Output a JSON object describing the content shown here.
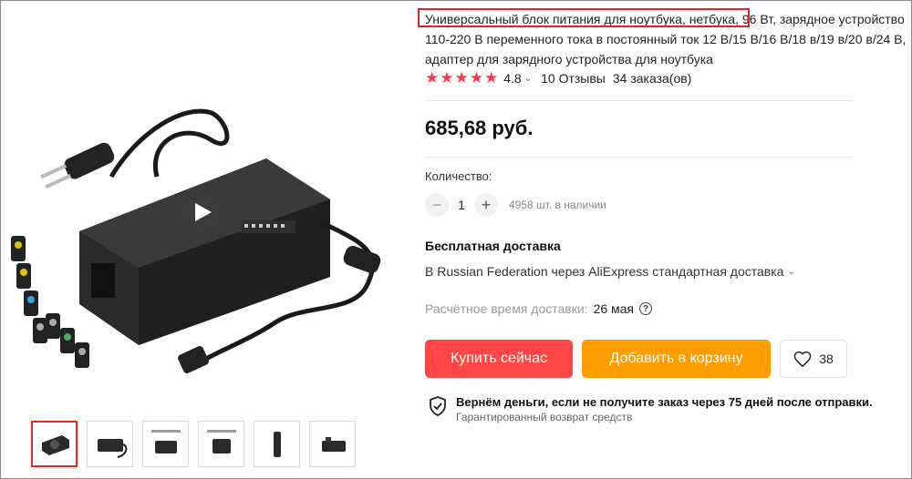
{
  "product": {
    "title": "Универсальный блок питания для ноутбука, нетбука, 96 Вт, зарядное устройство 110-220 В переменного тока в постоянный ток 12 В/15 В/16 В/18 в/19 в/20 в/24 В, адаптер для зарядного устройства для ноутбука",
    "rating": "4.8",
    "reviews": "10 Отзывы",
    "orders": "34 заказа(ов)",
    "price": "685,68 руб."
  },
  "quantity": {
    "label": "Количество:",
    "value": "1",
    "minus": "−",
    "plus": "+",
    "stock": "4958 шт. в наличии"
  },
  "shipping": {
    "title": "Бесплатная доставка",
    "description": "В Russian Federation через AliExpress стандартная доставка",
    "eta_label": "Расчётное время доставки:",
    "eta_date": "26 мая"
  },
  "actions": {
    "buy_now": "Купить сейчас",
    "add_to_cart": "Добавить в корзину",
    "wishlist_count": "38"
  },
  "guarantee": {
    "title": "Вернём деньги, если не получите заказ через 75 дней после отправки.",
    "subtitle": "Гарантированный возврат средств"
  },
  "icons": {
    "star": "star-icon",
    "play": "play-icon",
    "heart": "heart-icon",
    "shield": "shield-check-icon",
    "question": "question-icon"
  },
  "colors": {
    "buy": "#ff4747",
    "cart": "#ff9e00",
    "star": "#fd384f",
    "highlight": "#d9262c"
  }
}
